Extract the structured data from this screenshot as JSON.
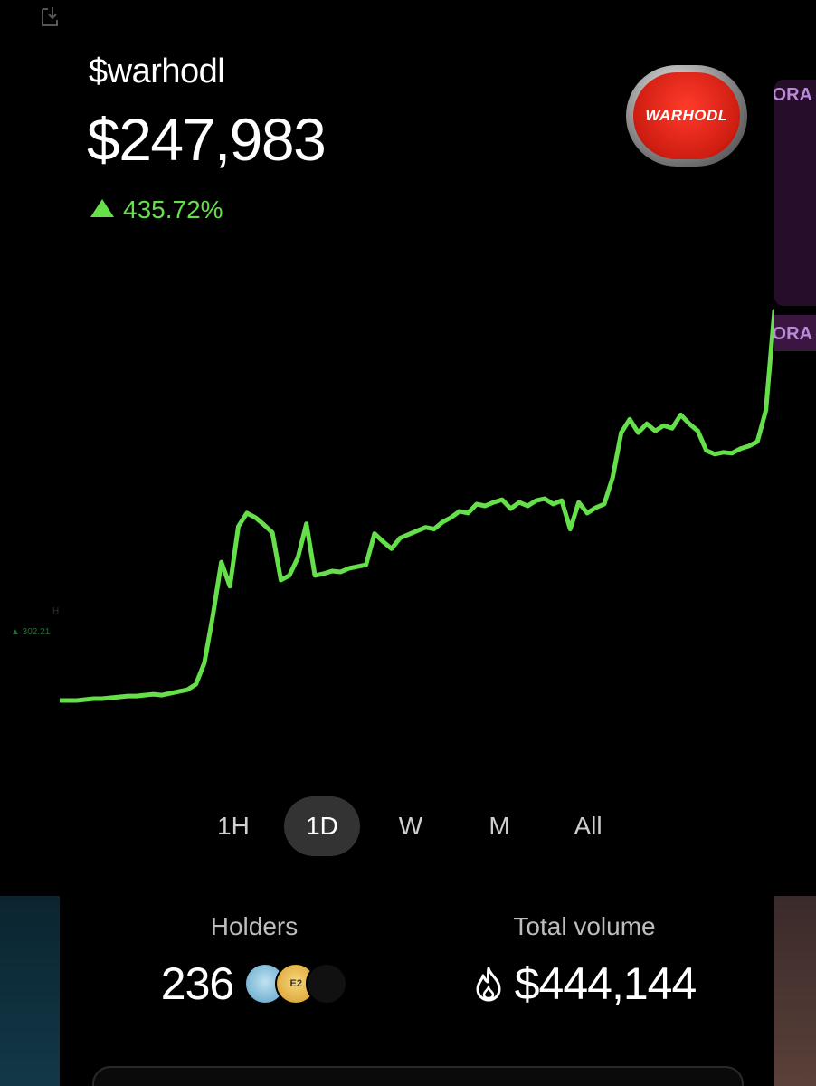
{
  "token": {
    "name": "$warhodl",
    "price": "$247,983",
    "change": "435.72%",
    "logo_text": "WARHODL"
  },
  "colors": {
    "positive": "#66e04a",
    "background": "#000000",
    "active_pill": "#333333"
  },
  "chart_data": {
    "type": "line",
    "y": [
      1.0,
      1.0,
      1.0,
      1.01,
      1.02,
      1.02,
      1.03,
      1.04,
      1.05,
      1.05,
      1.06,
      1.07,
      1.06,
      1.08,
      1.1,
      1.12,
      1.18,
      1.42,
      1.95,
      2.55,
      2.28,
      2.95,
      3.1,
      3.05,
      2.97,
      2.88,
      2.35,
      2.4,
      2.6,
      2.98,
      2.4,
      2.42,
      2.45,
      2.44,
      2.48,
      2.5,
      2.52,
      2.87,
      2.78,
      2.7,
      2.82,
      2.86,
      2.9,
      2.94,
      2.92,
      3.0,
      3.05,
      3.12,
      3.1,
      3.2,
      3.18,
      3.22,
      3.25,
      3.15,
      3.22,
      3.18,
      3.24,
      3.26,
      3.2,
      3.24,
      2.92,
      3.22,
      3.1,
      3.16,
      3.2,
      3.5,
      4.0,
      4.15,
      4.0,
      4.1,
      4.02,
      4.08,
      4.05,
      4.2,
      4.1,
      4.02,
      3.8,
      3.76,
      3.78,
      3.77,
      3.82,
      3.85,
      3.9,
      4.25,
      5.36
    ],
    "series_color": "#66e04a"
  },
  "ranges": [
    "1H",
    "1D",
    "W",
    "M",
    "All"
  ],
  "active_range": "1D",
  "stats": {
    "holders_label": "Holders",
    "holders_value": "236",
    "avatar2_text": "E2",
    "volume_label": "Total volume",
    "volume_value": "$444,144"
  },
  "background": {
    "right_tag": "ORA",
    "right_tag2": "ORA",
    "left_pct": "▲ 302.21",
    "left_h": "H"
  }
}
